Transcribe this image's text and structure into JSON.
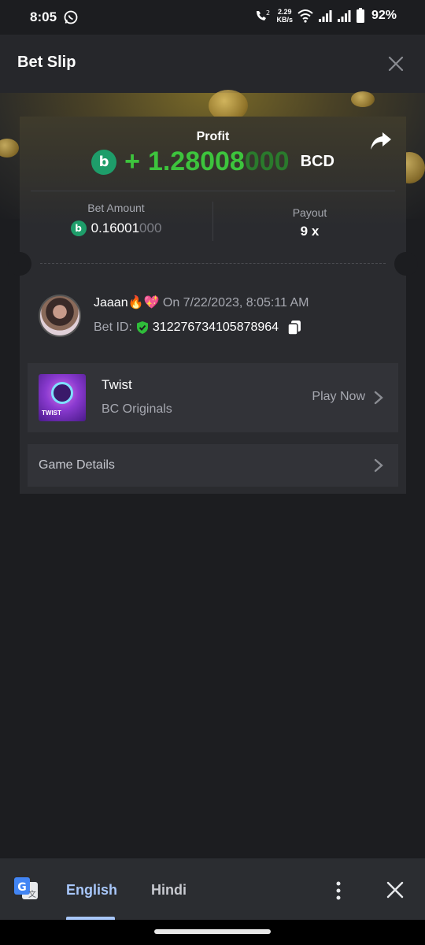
{
  "status_bar": {
    "time": "8:05",
    "speed_value": "2.29",
    "speed_unit": "KB/s",
    "battery": "92%",
    "icons": [
      "whatsapp-icon",
      "wifi-call-icon",
      "wifi-icon",
      "signal-icon",
      "battery-icon"
    ]
  },
  "header": {
    "title": "Bet Slip",
    "close_icon": "close-icon"
  },
  "profit": {
    "label": "Profit",
    "sign": "+",
    "value_main": "1.28008",
    "value_zeros": "000",
    "currency": "BCD",
    "coin_symbol": "b",
    "share_icon": "share-icon"
  },
  "bet_amount": {
    "label": "Bet Amount",
    "value_main": "0.16001",
    "value_zeros": "000"
  },
  "payout": {
    "label": "Payout",
    "value": "9 x"
  },
  "user": {
    "name": "Jaaan🔥💖",
    "on_text": "On 7/22/2023, 8:05:11 AM",
    "bet_id_label": "Bet ID:",
    "bet_id": "312276734105878964"
  },
  "game": {
    "name": "Twist",
    "provider": "BC Originals",
    "thumb_text": "TWIST",
    "play_label": "Play Now"
  },
  "details": {
    "label": "Game Details"
  },
  "translate_bar": {
    "lang_active": "English",
    "lang_other": "Hindi"
  },
  "colors": {
    "profit_green": "#3dc43d",
    "coin_green": "#1e9d6a",
    "accent_blue": "#a8c7fa",
    "background": "#1c1d20"
  }
}
